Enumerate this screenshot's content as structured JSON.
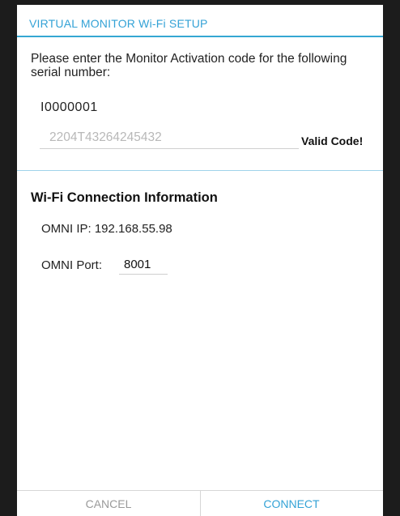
{
  "dialog": {
    "title": "VIRTUAL MONITOR Wi-Fi SETUP",
    "prompt": "Please enter the Monitor Activation code for the following serial number:",
    "serial_number": "I0000001",
    "activation_code_value": "2204T43264245432",
    "validation_status": "Valid Code!"
  },
  "wifi_section": {
    "header": "Wi-Fi Connection Information",
    "ip_text": "OMNI IP: 192.168.55.98",
    "port_label": "OMNI Port:",
    "port_value": "8001"
  },
  "buttons": {
    "cancel_label": "CANCEL",
    "connect_label": "CONNECT"
  },
  "colors": {
    "accent": "#33a2d6",
    "frame": "#1c1c1c",
    "disabled_text": "#9a9a9a"
  }
}
